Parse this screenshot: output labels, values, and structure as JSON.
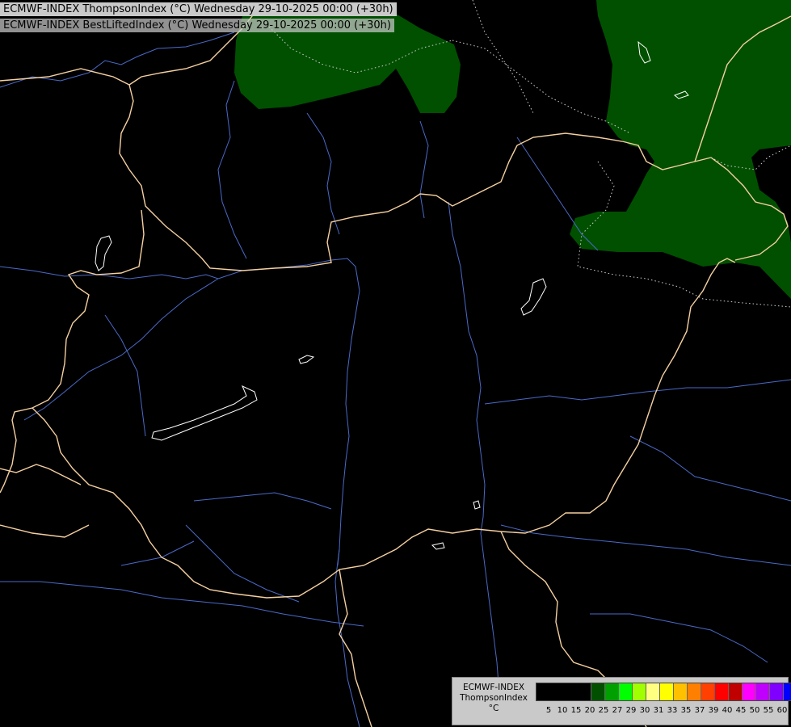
{
  "titles": {
    "line1": "ECMWF-INDEX ThompsonIndex (°C) Wednesday 29-10-2025 00:00 (+30h)",
    "line2": "ECMWF-INDEX BestLiftedIndex (°C) Wednesday 29-10-2025 00:00 (+30h)"
  },
  "legend": {
    "model": "ECMWF-INDEX",
    "parameter": "ThompsonIndex",
    "unit": "°C",
    "ticks": [
      "5",
      "10",
      "15",
      "20",
      "25",
      "27",
      "29",
      "30",
      "31",
      "33",
      "35",
      "37",
      "39",
      "40",
      "45",
      "50",
      "55",
      "60"
    ],
    "colors": [
      "#000000",
      "#005000",
      "#00a000",
      "#00ff00",
      "#a0ff00",
      "#ffff80",
      "#ffff00",
      "#ffc000",
      "#ff8000",
      "#ff4000",
      "#ff0000",
      "#c00000",
      "#ff00ff",
      "#c000ff",
      "#8000ff",
      "#0000ff"
    ]
  },
  "map_colors": {
    "background": "#000000",
    "field_fill": "#005000",
    "borders": "#f5d0a0",
    "rivers": "#4a6ac8",
    "lakes": "#ffffff",
    "contour": "#ffffff"
  }
}
